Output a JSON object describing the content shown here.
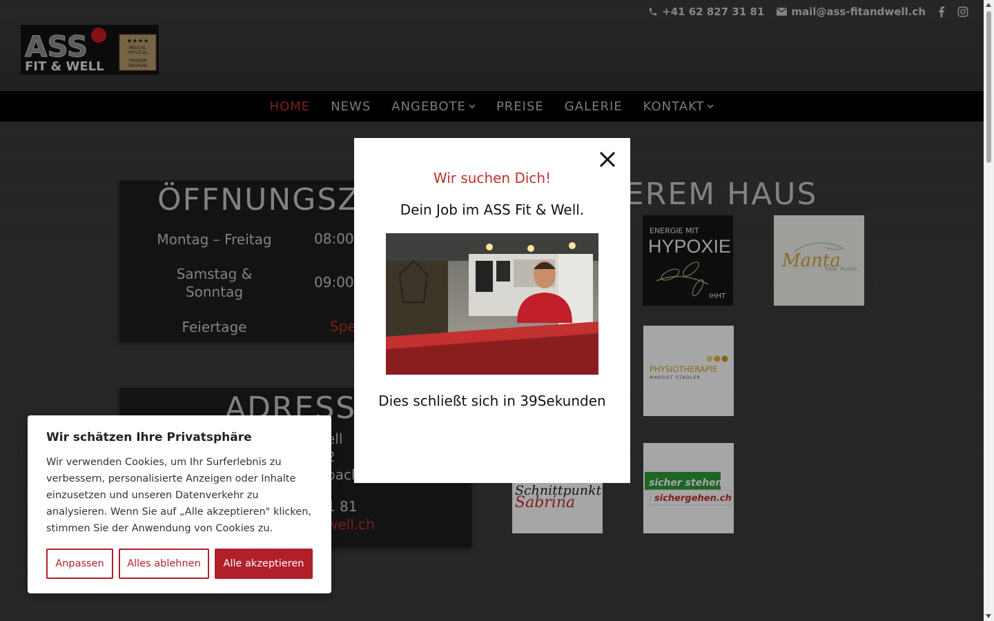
{
  "topbar": {
    "phone": "+41 62 827 31 81",
    "email": "mail@ass-fitandwell.ch",
    "social": [
      "facebook-icon",
      "instagram-icon"
    ]
  },
  "logo": {
    "brand_top": "ASS",
    "brand_bottom": "FIT & WELL",
    "badge_lines": [
      "MEDICAL",
      "PHYSICAL",
      "PREMIUM",
      "TRAINING"
    ]
  },
  "nav": {
    "items": [
      {
        "label": "HOME",
        "active": true,
        "dropdown": false
      },
      {
        "label": "NEWS",
        "active": false,
        "dropdown": false
      },
      {
        "label": "ANGEBOTE",
        "active": false,
        "dropdown": true
      },
      {
        "label": "PREISE",
        "active": false,
        "dropdown": false
      },
      {
        "label": "GALERIE",
        "active": false,
        "dropdown": false
      },
      {
        "label": "KONTAKT",
        "active": false,
        "dropdown": true
      }
    ]
  },
  "hours": {
    "title": "ÖFFNUNGSZE",
    "rows": [
      {
        "day": "Montag – Freitag",
        "time": "08:00"
      },
      {
        "day_lines": [
          "Samstag &",
          "Sonntag"
        ],
        "time": "09:00"
      },
      {
        "day": "Feiertage",
        "time": "Spe"
      }
    ]
  },
  "address": {
    "title": "ADRESSE",
    "lines": [
      "ell",
      "2",
      "bach",
      "1 81",
      "well.ch"
    ]
  },
  "haus": {
    "title": "EREM HAUS",
    "partners": {
      "hypoxie_line1": "ENERGIE MIT",
      "hypoxie_line2": "HYPOXIE",
      "hypoxie_line3": "IHHT",
      "manta": "Manta",
      "manta_sub": "YOGA · PILATES",
      "physio_line1": "PHYSIOTHERAPIE",
      "physio_line2": "MARGOT STADLER",
      "schnitt_line1": "Schnittpunkt",
      "schnitt_line2": "Sabrina",
      "sicher_line1": "sicher stehen",
      "sicher_line2": "sichergehen.ch"
    }
  },
  "popup": {
    "heading": "Wir suchen Dich!",
    "subheading": "Dein Job im ASS Fit & Well.",
    "countdown": "Dies schließt sich in 39Sekunden"
  },
  "cookie": {
    "title": "Wir schätzen Ihre Privatsphäre",
    "text": "Wir verwenden Cookies, um Ihr Surferlebnis zu verbessern, personalisierte Anzeigen oder Inhalte einzusetzen und unseren Datenverkehr zu analysieren. Wenn Sie auf „Alle akzeptieren\" klicken, stimmen Sie der Anwendung von Cookies zu.",
    "btn_customize": "Anpassen",
    "btn_reject": "Alles ablehnen",
    "btn_accept": "Alle akzeptieren"
  },
  "colors": {
    "accent": "#c0302b",
    "cookie_button": "#b11f2a",
    "nav_bg": "#000000"
  }
}
